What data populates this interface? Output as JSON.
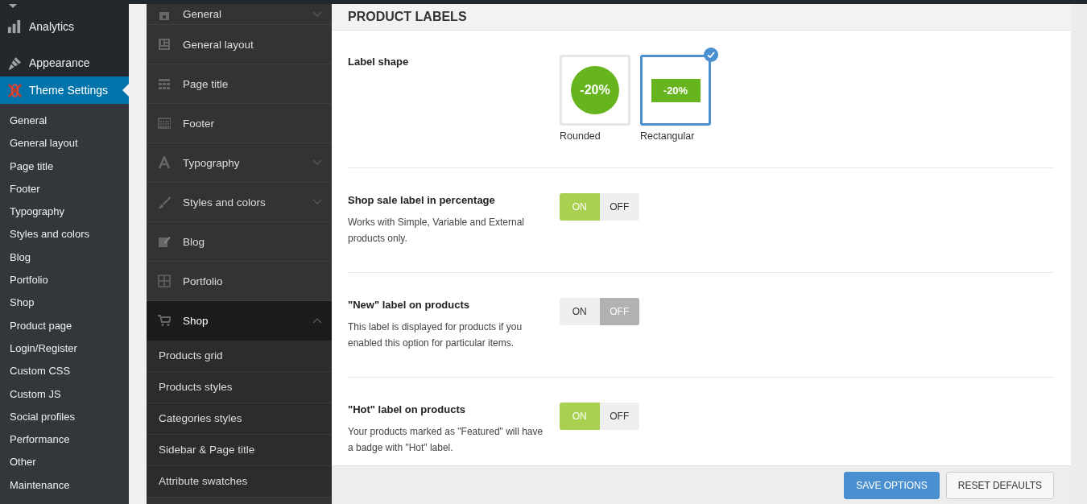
{
  "admin_menu": {
    "items": [
      {
        "label": "Analytics",
        "selected": false
      },
      {
        "label": "Appearance",
        "selected": false
      },
      {
        "label": "Theme Settings",
        "selected": true
      }
    ],
    "submenu": [
      "General",
      "General layout",
      "Page title",
      "Footer",
      "Typography",
      "Styles and colors",
      "Blog",
      "Portfolio",
      "Shop",
      "Product page",
      "Login/Register",
      "Custom CSS",
      "Custom JS",
      "Social profiles",
      "Performance",
      "Other",
      "Maintenance"
    ]
  },
  "theme_nav": {
    "items": [
      {
        "label": "General",
        "kind": "group",
        "expanded": false,
        "selected": false
      },
      {
        "label": "General layout",
        "kind": "page",
        "expanded": false,
        "selected": false
      },
      {
        "label": "Page title",
        "kind": "page",
        "expanded": false,
        "selected": false
      },
      {
        "label": "Footer",
        "kind": "page",
        "expanded": false,
        "selected": false
      },
      {
        "label": "Typography",
        "kind": "group",
        "expanded": false,
        "selected": false
      },
      {
        "label": "Styles and colors",
        "kind": "group",
        "expanded": false,
        "selected": false
      },
      {
        "label": "Blog",
        "kind": "page",
        "expanded": false,
        "selected": false
      },
      {
        "label": "Portfolio",
        "kind": "page",
        "expanded": false,
        "selected": false
      },
      {
        "label": "Shop",
        "kind": "group",
        "expanded": true,
        "selected": true,
        "children": [
          "Products grid",
          "Products styles",
          "Categories styles",
          "Sidebar & Page title",
          "Attribute swatches"
        ]
      }
    ]
  },
  "section": {
    "title": "PRODUCT LABELS",
    "settings": [
      {
        "kind": "shape",
        "label": "Label shape",
        "options": [
          {
            "label": "Rounded",
            "kind": "circle",
            "badge": "-20%",
            "selected": false
          },
          {
            "label": "Rectangular",
            "kind": "rect",
            "badge": "-20%",
            "selected": true
          }
        ]
      },
      {
        "kind": "toggle",
        "label": "Shop sale label in percentage",
        "description": "Works with Simple, Variable and External products only.",
        "on_label": "ON",
        "off_label": "OFF",
        "on": true
      },
      {
        "kind": "toggle",
        "label": "\"New\" label on products",
        "description": "This label is displayed for products if you enabled this option for particular items.",
        "on_label": "ON",
        "off_label": "OFF",
        "on": false
      },
      {
        "kind": "toggle",
        "label": "\"Hot\" label on products",
        "description": "Your products marked as \"Featured\" will have a badge with \"Hot\" label.",
        "on_label": "ON",
        "off_label": "OFF",
        "on": true
      }
    ]
  },
  "buttons": [
    {
      "label": "SAVE OPTIONS",
      "kind": "primary"
    },
    {
      "label": "RESET DEFAULTS",
      "kind": "secondary"
    }
  ]
}
